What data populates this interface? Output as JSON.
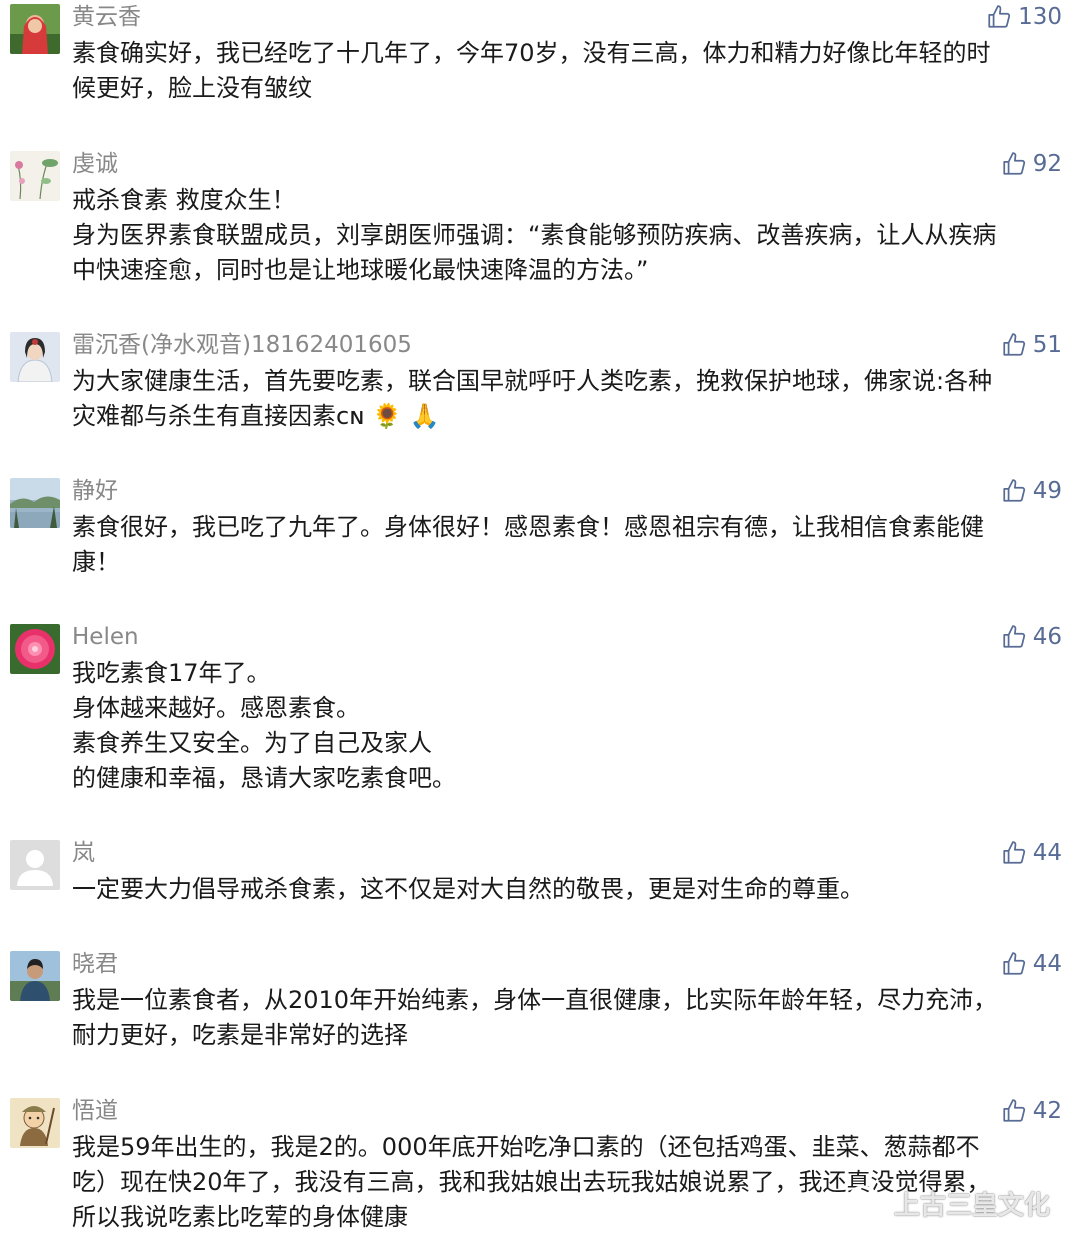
{
  "colors": {
    "like": "#576b95",
    "nickname": "#888888",
    "text": "#1a1a1a"
  },
  "comments": [
    {
      "nickname": "黄云香",
      "likes": "130",
      "avatar": "avatar-woman-red-scarf",
      "lines": [
        "素食确实好，我已经吃了十几年了，今年70岁，没有三高，体力和精力好像比年轻的时",
        "候更好，脸上没有皱纹"
      ]
    },
    {
      "nickname": "虔诚",
      "likes": "92",
      "avatar": "avatar-lotus-painting",
      "lines": [
        "戒杀食素 救度众生！",
        "身为医界素食联盟成员，刘享朗医师强调：“素食能够预防疾病、改善疾病，让人从疾病",
        "中快速痊愈，同时也是让地球暖化最快速降温的方法。”"
      ]
    },
    {
      "nickname": "雷沉香(净水观音)18162401605",
      "likes": "51",
      "avatar": "avatar-guanyin",
      "lines": [
        "为大家健康生活，首先要吃素，联合国早就呼吁人类吃素，挽救保护地球，佛家说:各种",
        "灾难都与杀生有直接因素ᴄɴ 🌻 🙏"
      ]
    },
    {
      "nickname": "静好",
      "likes": "49",
      "avatar": "avatar-landscape",
      "lines": [
        "素食很好，我已吃了九年了。身体很好！感恩素食！感恩祖宗有德，让我相信食素能健",
        "康！"
      ]
    },
    {
      "nickname": "Helen",
      "likes": "46",
      "avatar": "avatar-pink-flower",
      "lines": [
        "我吃素食17年了。",
        "身体越来越好。感恩素食。",
        "素食养生又安全。为了自己及家人",
        "的健康和幸福，恳请大家吃素食吧。"
      ]
    },
    {
      "nickname": "岚",
      "likes": "44",
      "avatar": "avatar-default",
      "lines": [
        "一定要大力倡导戒杀食素，这不仅是对大自然的敬畏，更是对生命的尊重。"
      ]
    },
    {
      "nickname": "晓君",
      "likes": "44",
      "avatar": "avatar-woman-outdoor",
      "lines": [
        "我是一位素食者，从2010年开始纯素，身体一直很健康，比实际年龄年轻，尽力充沛，",
        "耐力更好，吃素是非常好的选择"
      ]
    },
    {
      "nickname": "悟道",
      "likes": "42",
      "avatar": "avatar-cartoon-monk",
      "lines": [
        "我是59年出生的，我是2的。000年底开始吃净口素的（还包括鸡蛋、韭菜、葱蒜都不",
        "吃）现在快20年了，我没有三高，我和我姑娘出去玩我姑娘说累了，我还真没觉得累，",
        "所以我说吃素比吃荤的身体健康"
      ]
    }
  ],
  "watermark": {
    "text": "上古三皇文化",
    "icon": "wechat-icon"
  }
}
